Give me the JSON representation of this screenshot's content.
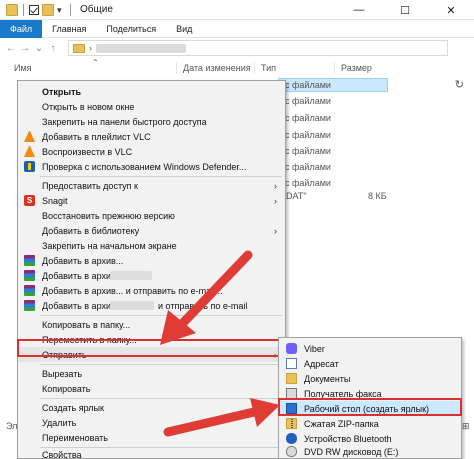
{
  "window": {
    "title": "Общие",
    "controls": {
      "minimize": "—",
      "maximize": "☐",
      "close": "✕"
    }
  },
  "ribbon": {
    "tabs": [
      "Файл",
      "Главная",
      "Поделиться",
      "Вид"
    ]
  },
  "columns": {
    "name": "Имя",
    "date": "Дата изменения",
    "type": "Тип",
    "size": "Размер"
  },
  "file_list": {
    "types": [
      "с файлами",
      "с файлами",
      "с файлами",
      "с файлами",
      "с файлами",
      "с файлами",
      "с файлами"
    ],
    "dat_label": "DAT\"",
    "size": "8 КБ",
    "bottom_left": "Эл",
    "bottom_right": "⊞"
  },
  "context_menu": {
    "items": [
      {
        "label": "Открыть",
        "bold": true
      },
      {
        "label": "Открыть в новом окне"
      },
      {
        "label": "Закрепить на панели быстрого доступа"
      },
      {
        "label": "Добавить в плейлист VLC"
      },
      {
        "label": "Воспроизвести в VLC"
      },
      {
        "label": "Проверка с использованием Windows Defender..."
      },
      {
        "label": "Предоставить доступ к"
      },
      {
        "label": "Snagit"
      },
      {
        "label": "Восстановить прежнюю версию"
      },
      {
        "label": "Добавить в библиотеку"
      },
      {
        "label": "Закрепить на начальном экране"
      },
      {
        "label": "Добавить в архив..."
      },
      {
        "label": "Добавить в архив"
      },
      {
        "label": "Добавить в архив... и отправить по e-mail..."
      },
      {
        "label": "Добавить в архив"
      },
      {
        "label": "и отправить по e-mail"
      },
      {
        "label": "Копировать в папку..."
      },
      {
        "label": "Переместить в папку..."
      },
      {
        "label": "Отправить"
      },
      {
        "label": "Вырезать"
      },
      {
        "label": "Копировать"
      },
      {
        "label": "Создать ярлык"
      },
      {
        "label": "Удалить"
      },
      {
        "label": "Переименовать"
      },
      {
        "label": "Свойства"
      }
    ]
  },
  "send_to_menu": {
    "items": [
      {
        "label": "Viber"
      },
      {
        "label": "Адресат"
      },
      {
        "label": "Документы"
      },
      {
        "label": "Получатель факса"
      },
      {
        "label": "Рабочий стол (создать ярлык)"
      },
      {
        "label": "Сжатая ZIP-папка"
      },
      {
        "label": "Устройство Bluetooth"
      },
      {
        "label": "DVD RW дисковод (E:)"
      }
    ]
  },
  "colors": {
    "file_tab": "#1979ca",
    "highlight_red": "#d9322c",
    "selection": "#cce8ff"
  }
}
